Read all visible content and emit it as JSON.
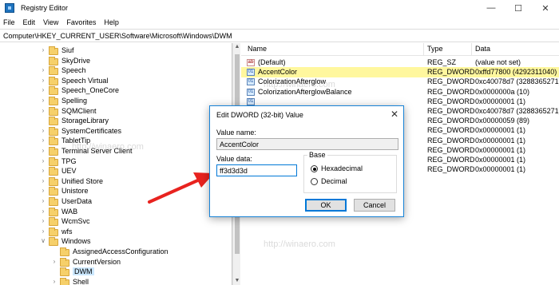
{
  "window": {
    "title": "Registry Editor",
    "minimize": "—",
    "maximize": "☐",
    "close": "✕"
  },
  "menu": [
    "File",
    "Edit",
    "View",
    "Favorites",
    "Help"
  ],
  "address": "Computer\\HKEY_CURRENT_USER\\Software\\Microsoft\\Windows\\DWM",
  "tree": [
    {
      "label": "Siuf",
      "expandable": true,
      "level": 0
    },
    {
      "label": "SkyDrive",
      "expandable": false,
      "level": 0
    },
    {
      "label": "Speech",
      "expandable": true,
      "level": 0
    },
    {
      "label": "Speech Virtual",
      "expandable": true,
      "level": 0
    },
    {
      "label": "Speech_OneCore",
      "expandable": true,
      "level": 0
    },
    {
      "label": "Spelling",
      "expandable": true,
      "level": 0
    },
    {
      "label": "SQMClient",
      "expandable": true,
      "level": 0
    },
    {
      "label": "StorageLibrary",
      "expandable": false,
      "level": 0
    },
    {
      "label": "SystemCertificates",
      "expandable": true,
      "level": 0
    },
    {
      "label": "TabletTip",
      "expandable": true,
      "level": 0
    },
    {
      "label": "Terminal Server Client",
      "expandable": true,
      "level": 0
    },
    {
      "label": "TPG",
      "expandable": true,
      "level": 0
    },
    {
      "label": "UEV",
      "expandable": true,
      "level": 0
    },
    {
      "label": "Unified Store",
      "expandable": true,
      "level": 0
    },
    {
      "label": "Unistore",
      "expandable": true,
      "level": 0
    },
    {
      "label": "UserData",
      "expandable": true,
      "level": 0
    },
    {
      "label": "WAB",
      "expandable": true,
      "level": 0
    },
    {
      "label": "WcmSvc",
      "expandable": true,
      "level": 0
    },
    {
      "label": "wfs",
      "expandable": true,
      "level": 0
    },
    {
      "label": "Windows",
      "expandable": true,
      "expanded": true,
      "level": 0
    },
    {
      "label": "AssignedAccessConfiguration",
      "expandable": false,
      "level": 1
    },
    {
      "label": "CurrentVersion",
      "expandable": true,
      "level": 1
    },
    {
      "label": "DWM",
      "expandable": false,
      "level": 1,
      "selected": true
    },
    {
      "label": "Shell",
      "expandable": true,
      "level": 1
    }
  ],
  "columns": {
    "name": "Name",
    "type": "Type",
    "data": "Data"
  },
  "values": [
    {
      "name": "(Default)",
      "type": "REG_SZ",
      "data": "(value not set)",
      "icon": "sz"
    },
    {
      "name": "AccentColor",
      "type": "REG_DWORD",
      "data": "0xffd77800 (4292311040)",
      "icon": "dw",
      "highlight": true
    },
    {
      "name": "ColorizationAfterglow",
      "type": "REG_DWORD",
      "data": "0xc40078d7 (3288365271)",
      "icon": "dw"
    },
    {
      "name": "ColorizationAfterglowBalance",
      "type": "REG_DWORD",
      "data": "0x0000000a (10)",
      "icon": "dw"
    },
    {
      "name": "",
      "type": "REG_DWORD",
      "data": "0x00000001 (1)",
      "icon": "dw"
    },
    {
      "name": "",
      "type": "REG_DWORD",
      "data": "0xc40078d7 (3288365271)",
      "icon": "dw"
    },
    {
      "name": "",
      "type": "REG_DWORD",
      "data": "0x00000059 (89)",
      "icon": "dw"
    },
    {
      "name": "",
      "type": "REG_DWORD",
      "data": "0x00000001 (1)",
      "icon": "dw"
    },
    {
      "name": "",
      "type": "REG_DWORD",
      "data": "0x00000001 (1)",
      "icon": "dw"
    },
    {
      "name": "",
      "type": "REG_DWORD",
      "data": "0x00000001 (1)",
      "icon": "dw"
    },
    {
      "name": "",
      "type": "REG_DWORD",
      "data": "0x00000001 (1)",
      "icon": "dw"
    },
    {
      "name": "",
      "type": "REG_DWORD",
      "data": "0x00000001 (1)",
      "icon": "dw"
    }
  ],
  "dialog": {
    "title": "Edit DWORD (32-bit) Value",
    "close": "✕",
    "value_name_label": "Value name:",
    "value_name": "AccentColor",
    "value_data_label": "Value data:",
    "value_data": "ff3d3d3d",
    "base_label": "Base",
    "hex_label": "Hexadecimal",
    "dec_label": "Decimal",
    "base_selected": "Hexadecimal",
    "ok_label": "OK",
    "cancel_label": "Cancel"
  },
  "watermark": "http://winaero.com",
  "colors": {
    "accent": "#0078d7",
    "highlight": "#fff79e",
    "arrow": "#e8231f",
    "selection": "#cce8ff"
  }
}
